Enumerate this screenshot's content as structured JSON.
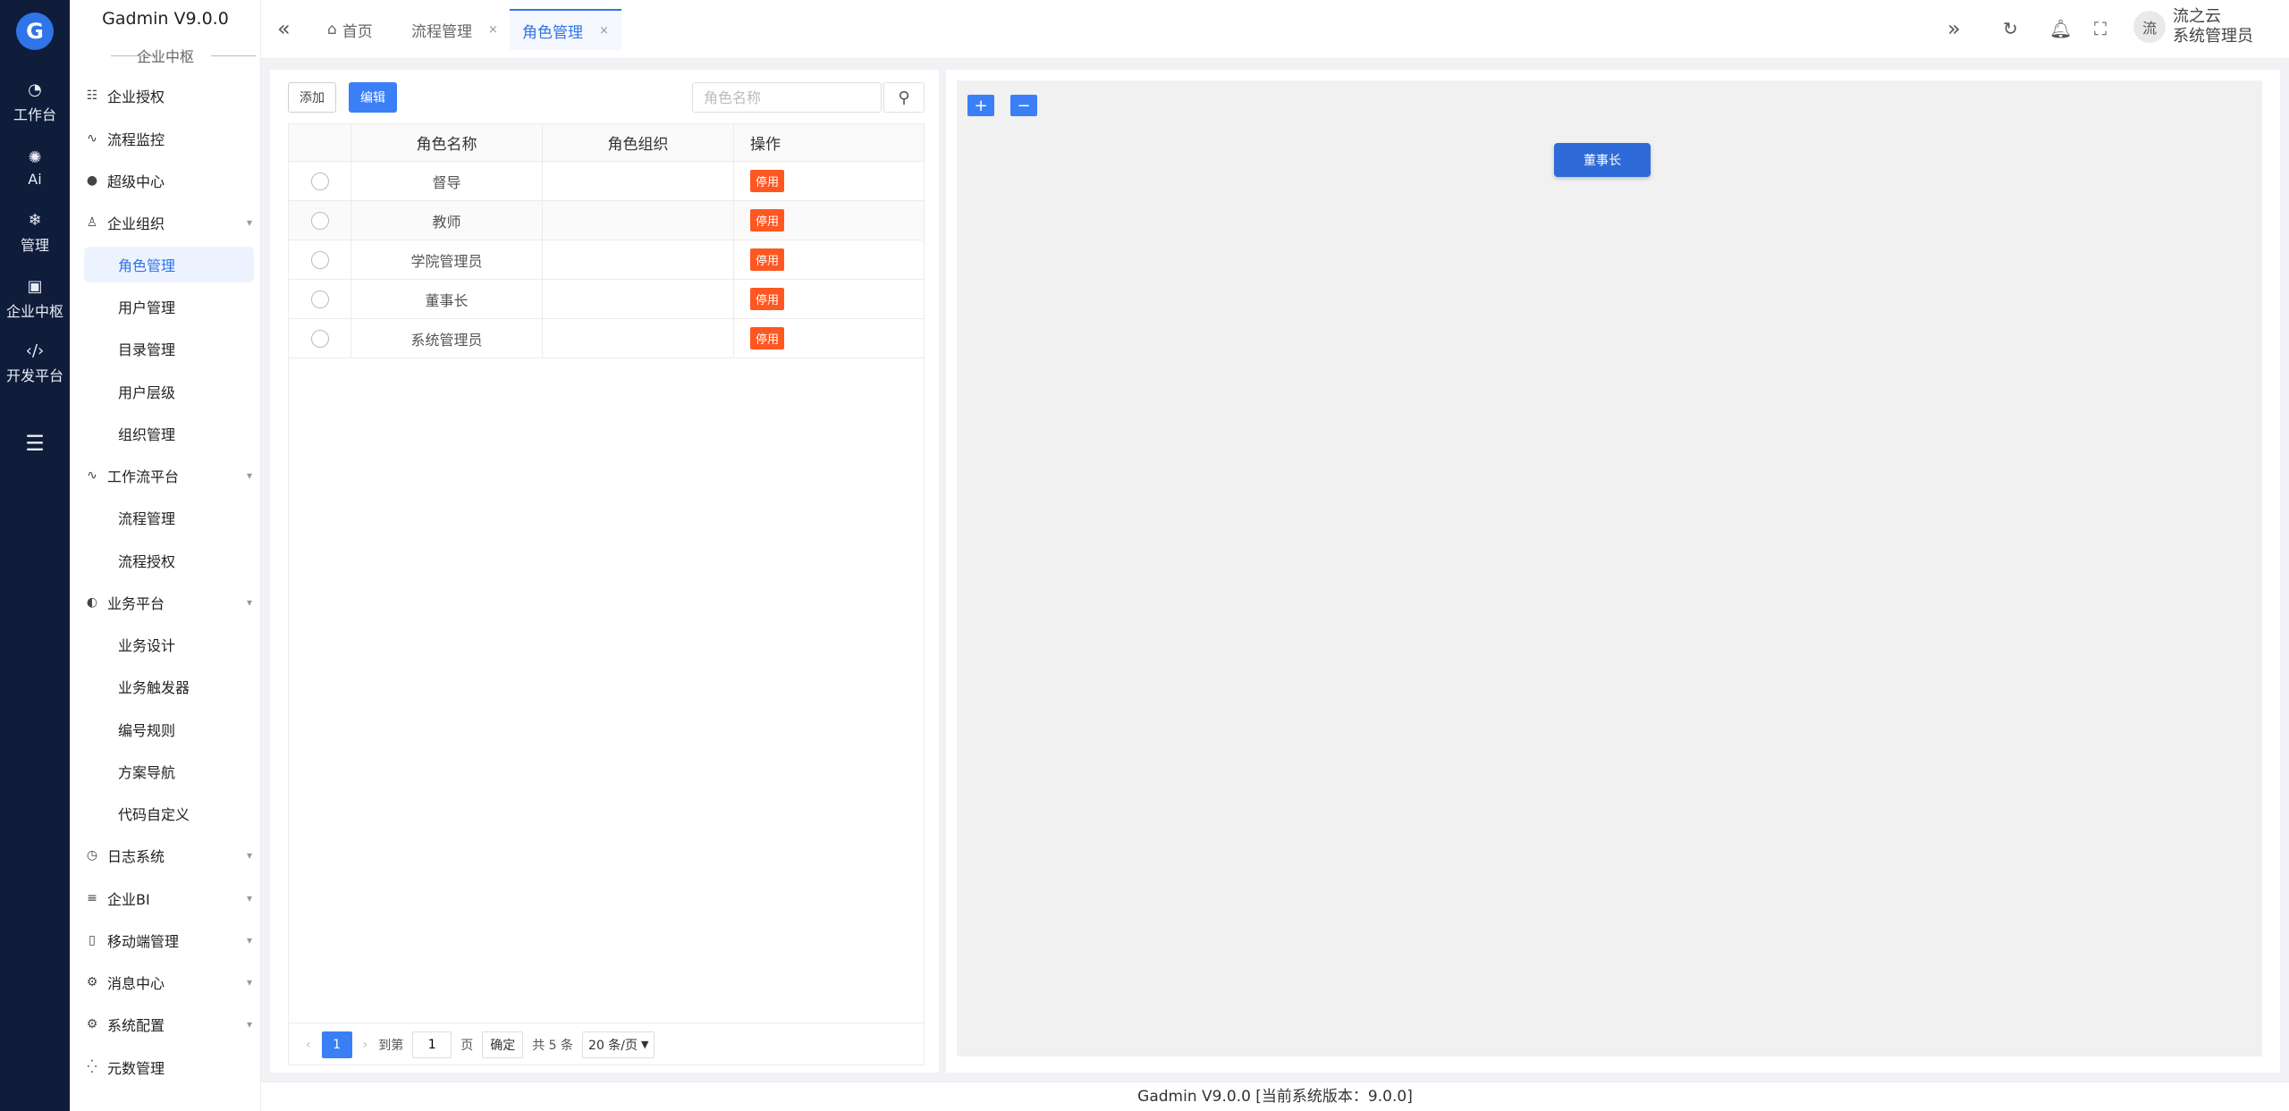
{
  "rail": {
    "logo": "G",
    "items": [
      {
        "label": "工作台",
        "icon": "dashboard-icon"
      },
      {
        "label": "Ai",
        "icon": "ai-icon"
      },
      {
        "label": "管理",
        "icon": "snowflake-icon"
      },
      {
        "label": "企业中枢",
        "icon": "apps-icon"
      },
      {
        "label": "开发平台",
        "icon": "code-icon"
      }
    ]
  },
  "menu": {
    "brand": "Gadmin V9.0.0",
    "section": "企业中枢",
    "items": [
      {
        "label": "企业授权"
      },
      {
        "label": "流程监控"
      },
      {
        "label": "超级中心"
      },
      {
        "label": "企业组织"
      },
      {
        "label": "角色管理"
      },
      {
        "label": "用户管理"
      },
      {
        "label": "目录管理"
      },
      {
        "label": "用户层级"
      },
      {
        "label": "组织管理"
      },
      {
        "label": "工作流平台"
      },
      {
        "label": "流程管理"
      },
      {
        "label": "流程授权"
      },
      {
        "label": "业务平台"
      },
      {
        "label": "业务设计"
      },
      {
        "label": "业务触发器"
      },
      {
        "label": "编号规则"
      },
      {
        "label": "方案导航"
      },
      {
        "label": "代码自定义"
      },
      {
        "label": "日志系统"
      },
      {
        "label": "企业BI"
      },
      {
        "label": "移动端管理"
      },
      {
        "label": "消息中心"
      },
      {
        "label": "系统配置"
      },
      {
        "label": "元数管理"
      }
    ]
  },
  "tabs": [
    {
      "label": "首页"
    },
    {
      "label": "流程管理"
    },
    {
      "label": "角色管理"
    }
  ],
  "user": {
    "avatar": "流",
    "name": "流之云",
    "role": "系统管理员"
  },
  "toolbar": {
    "add": "添加",
    "edit": "编辑",
    "search_placeholder": "角色名称"
  },
  "table": {
    "headers": [
      "角色名称",
      "角色组织",
      "操作"
    ],
    "rows": [
      {
        "name": "督导",
        "org": "",
        "action": "停用"
      },
      {
        "name": "教师",
        "org": "",
        "action": "停用"
      },
      {
        "name": "学院管理员",
        "org": "",
        "action": "停用"
      },
      {
        "name": "董事长",
        "org": "",
        "action": "停用"
      },
      {
        "name": "系统管理员",
        "org": "",
        "action": "停用"
      }
    ]
  },
  "pager": {
    "current": "1",
    "goto_label": "到第",
    "goto_value": "1",
    "page_unit": "页",
    "confirm": "确定",
    "total": "共 5 条",
    "size": "20 条/页"
  },
  "canvas": {
    "zoom_in": "+",
    "zoom_out": "−",
    "node": "董事长"
  },
  "footer": "Gadmin V9.0.0 [当前系统版本：9.0.0]"
}
